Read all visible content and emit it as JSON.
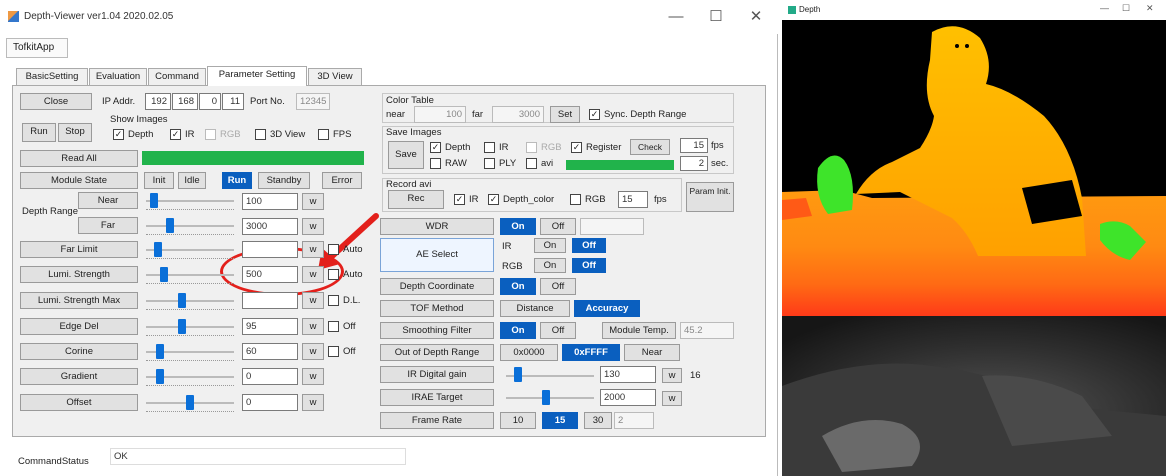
{
  "window": {
    "title": "Depth-Viewer ver1.04 2020.02.05",
    "minimize": "—",
    "maximize": "☐",
    "close": "✕"
  },
  "menu": {
    "item": "TofkitApp"
  },
  "tabs": [
    "BasicSetting",
    "Evaluation",
    "Command",
    "Parameter Setting",
    "3D View"
  ],
  "connection": {
    "close": "Close",
    "ip_label": "IP Addr.",
    "ip": [
      "192",
      "168",
      "0",
      "11"
    ],
    "port_label": "Port No.",
    "port": "12345"
  },
  "show_images": {
    "label": "Show Images",
    "depth": "Depth",
    "ir": "IR",
    "rgb": "RGB",
    "view3d": "3D View",
    "fps": "FPS"
  },
  "run": "Run",
  "stop": "Stop",
  "read_all": "Read All",
  "module_state": {
    "label": "Module State",
    "init": "Init",
    "idle": "Idle",
    "run": "Run",
    "standby": "Standby",
    "error": "Error"
  },
  "depth_range": {
    "label": "Depth Range",
    "near": "Near",
    "far": "Far",
    "near_val": "100",
    "far_val": "3000"
  },
  "params": [
    {
      "name": "Far Limit",
      "value": "",
      "unit": "w",
      "extra": "Auto",
      "level": 0.05
    },
    {
      "name": "Lumi. Strength",
      "value": "500",
      "unit": "w",
      "extra": "Auto",
      "level": 0.12
    },
    {
      "name": "Lumi. Strength Max",
      "value": "",
      "unit": "w",
      "extra": "D.L.",
      "level": 0.35
    },
    {
      "name": "Edge Del",
      "value": "95",
      "unit": "w",
      "extra": "Off",
      "level": 0.35
    },
    {
      "name": "Corine",
      "value": "60",
      "unit": "w",
      "extra": "Off",
      "level": 0.08
    },
    {
      "name": "Gradient",
      "value": "0",
      "unit": "w",
      "extra": "",
      "level": 0.08
    },
    {
      "name": "Offset",
      "value": "0",
      "unit": "w",
      "extra": "",
      "level": 0.45
    }
  ],
  "color_table": {
    "label": "Color Table",
    "near_label": "near",
    "near": "100",
    "far_label": "far",
    "far": "3000",
    "set": "Set",
    "sync": "Sync. Depth Range"
  },
  "save_images": {
    "label": "Save Images",
    "save": "Save",
    "depth": "Depth",
    "ir": "IR",
    "rgb": "RGB",
    "register": "Register",
    "check": "Check",
    "raw": "RAW",
    "ply": "PLY",
    "avi": "avi",
    "fps": "15",
    "fps_unit": "fps",
    "sec": "2",
    "sec_unit": "sec."
  },
  "record": {
    "label": "Record avi",
    "rec": "Rec",
    "ir": "IR",
    "depth_color": "Depth_color",
    "rgb": "RGB",
    "fps": "15",
    "fps_unit": "fps",
    "param_init": "Param Init."
  },
  "wdr": {
    "label": "WDR",
    "on": "On",
    "off": "Off"
  },
  "ae": {
    "label": "AE Select",
    "ir": "IR",
    "rgb": "RGB",
    "on": "On",
    "off": "Off"
  },
  "depth_coord": {
    "label": "Depth Coordinate",
    "on": "On",
    "off": "Off"
  },
  "tof_method": {
    "label": "TOF Method",
    "distance": "Distance",
    "accuracy": "Accuracy"
  },
  "smoothing": {
    "label": "Smoothing Filter",
    "on": "On",
    "off": "Off",
    "temp_label": "Module Temp.",
    "temp": "45.2"
  },
  "out_of_range": {
    "label": "Out of Depth Range",
    "v1": "0x0000",
    "v2": "0xFFFF",
    "near": "Near"
  },
  "ir_gain": {
    "label": "IR Digital gain",
    "value": "130",
    "unit": "w",
    "readout": "16",
    "level": 0.05
  },
  "irae": {
    "label": "IRAE Target",
    "value": "2000",
    "unit": "w",
    "level": 0.4
  },
  "frame_rate": {
    "label": "Frame Rate",
    "r1": "10",
    "r2": "15",
    "r3": "30",
    "r4": "2"
  },
  "status": {
    "label": "CommandStatus",
    "value": "OK"
  },
  "depth_window": {
    "title": "Depth",
    "minimize": "—",
    "maximize": "☐",
    "close": "✕"
  },
  "colors": {
    "accent": "#0a5fbf",
    "progress": "#21b34b",
    "highlight": "#e3201b"
  }
}
